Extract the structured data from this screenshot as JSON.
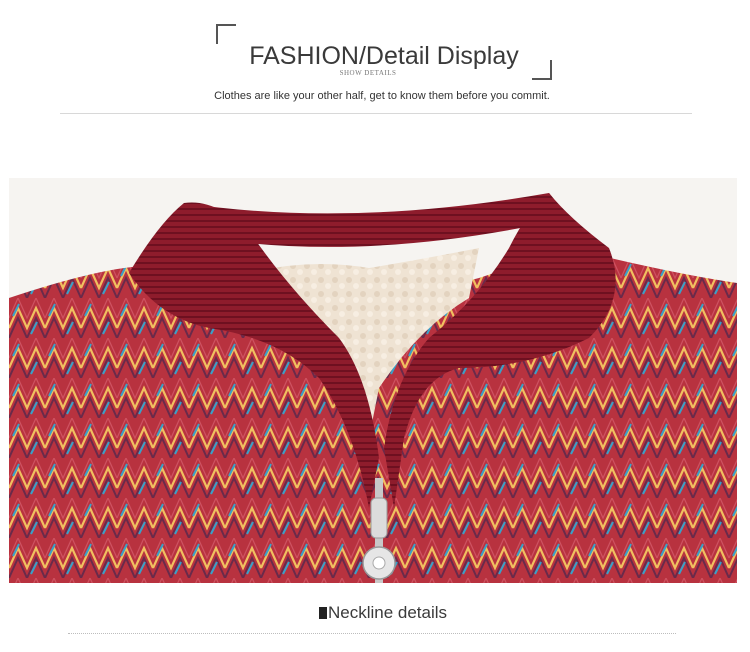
{
  "header": {
    "title": "FASHION/Detail Display",
    "subtitle": "SHOW DETAILS",
    "tagline": "Clothes are like your other half, get to know them before you commit."
  },
  "product_image": {
    "description_icon": "sweater-neckline-photo",
    "colors": {
      "fabric": "#b8323f",
      "collar": "#8e1c2c",
      "lining": "#efe3d3",
      "stripe_yellow": "#f0c060",
      "stripe_blue": "#3aa0c8"
    }
  },
  "caption": {
    "label": "Neckline details"
  }
}
